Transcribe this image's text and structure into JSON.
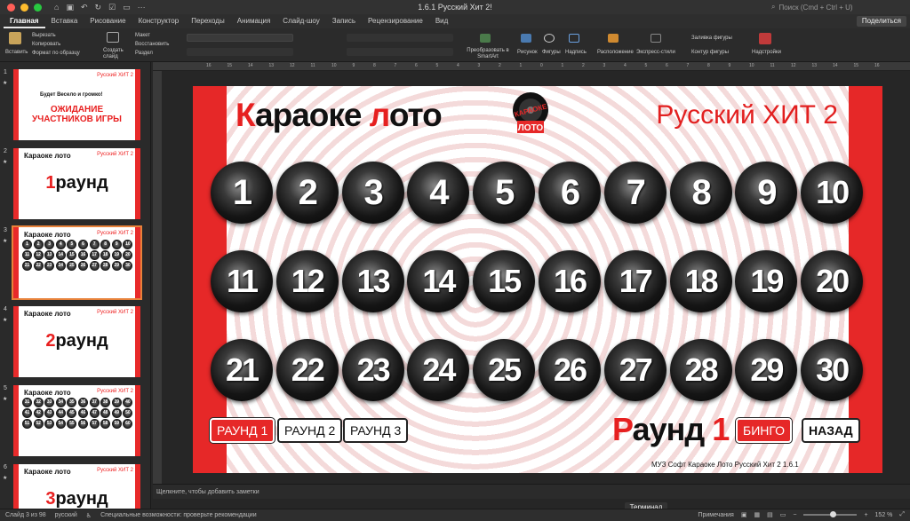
{
  "window": {
    "title": "1.6.1 Русский Хит 2!",
    "search_placeholder": "Поиск (Cmd + Ctrl + U)",
    "share_label": "Поделиться"
  },
  "tabs": [
    "Главная",
    "Вставка",
    "Рисование",
    "Конструктор",
    "Переходы",
    "Анимация",
    "Слайд-шоу",
    "Запись",
    "Рецензирование",
    "Вид"
  ],
  "ribbon": {
    "paste": "Вставить",
    "cut": "Вырезать",
    "copy": "Копировать",
    "format": "Формат по образцу",
    "new_slide": "Создать слайд",
    "layout": "Макет",
    "reset": "Восстановить",
    "section": "Раздел",
    "smartart": "Преобразовать в SmartArt",
    "picture": "Рисунок",
    "shapes": "Фигуры",
    "textbox": "Надпись",
    "arrange": "Расположение",
    "quick_styles": "Экспресс-стили",
    "shape_fill": "Заливка фигуры",
    "shape_outline": "Контур фигуры",
    "addins": "Надстройки"
  },
  "ruler_marks": [
    "16",
    "15",
    "14",
    "13",
    "12",
    "11",
    "10",
    "9",
    "8",
    "7",
    "6",
    "5",
    "4",
    "3",
    "2",
    "1",
    "0",
    "1",
    "2",
    "3",
    "4",
    "5",
    "6",
    "7",
    "8",
    "9",
    "10",
    "11",
    "12",
    "13",
    "14",
    "15",
    "16"
  ],
  "thumbnails": [
    {
      "num": "1",
      "kind": "wait",
      "title": "Будет Весело и громко!",
      "big": "ОЖИДАНИЕ УЧАСТНИКОВ ИГРЫ",
      "hit": "Русский ХИТ 2"
    },
    {
      "num": "2",
      "kind": "round",
      "title": "Караоке лото",
      "big": "1 раунд",
      "big_num": "1",
      "big_word": "раунд",
      "hit": "Русский ХИТ 2"
    },
    {
      "num": "3",
      "kind": "grid",
      "title": "Караоке лото",
      "hit": "Русский ХИТ 2",
      "nums": [
        "1",
        "2",
        "3",
        "4",
        "5",
        "6",
        "7",
        "8",
        "9",
        "10",
        "11",
        "12",
        "13",
        "14",
        "15",
        "16",
        "17",
        "18",
        "19",
        "20",
        "21",
        "22",
        "23",
        "24",
        "25",
        "26",
        "27",
        "28",
        "29",
        "30"
      ]
    },
    {
      "num": "4",
      "kind": "round",
      "title": "Караоке лото",
      "big_num": "2",
      "big_word": "раунд",
      "hit": "Русский ХИТ 2"
    },
    {
      "num": "5",
      "kind": "grid",
      "title": "Караоке лото",
      "hit": "Русский ХИТ 2",
      "nums": [
        "31",
        "32",
        "33",
        "34",
        "35",
        "36",
        "37",
        "38",
        "39",
        "40",
        "41",
        "42",
        "43",
        "44",
        "45",
        "46",
        "47",
        "48",
        "49",
        "50",
        "51",
        "52",
        "53",
        "54",
        "55",
        "56",
        "57",
        "58",
        "59",
        "60"
      ]
    },
    {
      "num": "6",
      "kind": "round",
      "title": "Караоке лото",
      "big_num": "3",
      "big_word": "раунд",
      "hit": "Русский ХИТ 2"
    }
  ],
  "slide": {
    "title_first": "К",
    "title_rest1": "араоке ",
    "title_l": "л",
    "title_rest2": "ото",
    "hit": "Русский ХИТ 2",
    "logo_top": "КАРАОКЕ",
    "logo_bottom": "ЛОТО",
    "numbers": [
      "1",
      "2",
      "3",
      "4",
      "5",
      "6",
      "7",
      "8",
      "9",
      "10",
      "11",
      "12",
      "13",
      "14",
      "15",
      "16",
      "17",
      "18",
      "19",
      "20",
      "21",
      "22",
      "23",
      "24",
      "25",
      "26",
      "27",
      "28",
      "29",
      "30"
    ],
    "round_buttons": [
      "РАУНД 1",
      "РАУНД 2",
      "РАУНД 3"
    ],
    "round_label_first": "Р",
    "round_label_rest": "аунд ",
    "round_label_num": "1",
    "bingo": "БИНГО",
    "back": "НАЗАД",
    "footer": "МУЗ Софт Караоке Лото Русский Хит 2 1.6.1"
  },
  "notes_placeholder": "Щелкните, чтобы добавить заметки",
  "terminal": "Терминал",
  "status": {
    "slide": "Слайд 3 из 98",
    "lang": "русский",
    "accessibility": "Специальные возможности: проверьте рекомендации",
    "notes": "Примечания",
    "zoom": "152 %"
  },
  "colors": {
    "accent": "#e62828",
    "frame": "#262626"
  }
}
